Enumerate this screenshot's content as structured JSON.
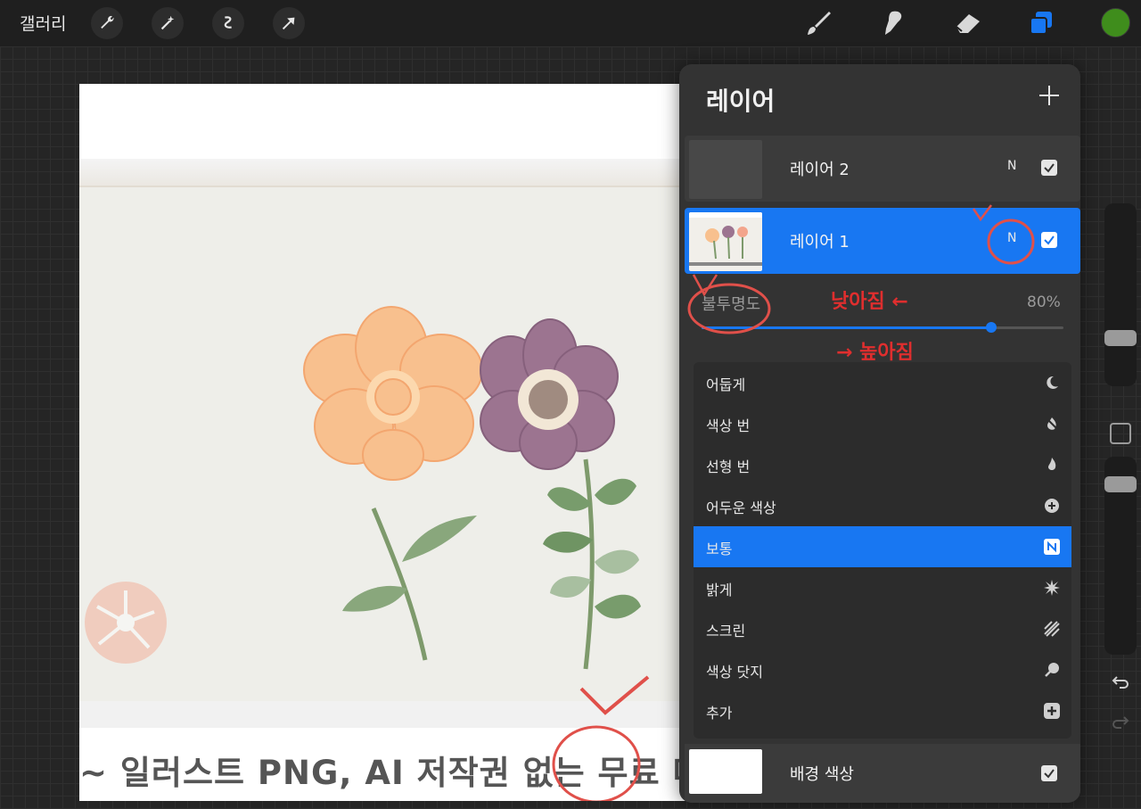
{
  "topbar": {
    "gallery_label": "갤러리",
    "tools_left": [
      {
        "name": "wrench-icon"
      },
      {
        "name": "magic-wand-icon"
      },
      {
        "name": "selection-icon"
      },
      {
        "name": "transform-arrow-icon"
      }
    ],
    "tools_right": [
      {
        "name": "brush-icon"
      },
      {
        "name": "smudge-icon"
      },
      {
        "name": "eraser-icon"
      },
      {
        "name": "layers-icon"
      }
    ],
    "current_color": "#3f8d1c",
    "accent_color": "#1877f2"
  },
  "canvas": {
    "caption": "~ 일러스트 PNG, AI 저작권 없는 무료 다"
  },
  "layers_panel": {
    "title": "레이어",
    "add_icon": "plus-icon",
    "layers": [
      {
        "name": "레이어 2",
        "blend": "N",
        "visible": true,
        "selected": false
      },
      {
        "name": "레이어 1",
        "blend": "N",
        "visible": true,
        "selected": true
      }
    ],
    "opacity": {
      "label": "불투명도",
      "value_text": "80%",
      "value": 0.8
    },
    "blend_modes": [
      {
        "label": "어둡게",
        "icon": "moon-icon",
        "active": false
      },
      {
        "label": "색상 번",
        "icon": "burn-icon",
        "active": false
      },
      {
        "label": "선형 번",
        "icon": "flame-icon",
        "active": false
      },
      {
        "label": "어두운 색상",
        "icon": "plus-circle-icon",
        "active": false
      },
      {
        "label": "보통",
        "icon": "n-badge-icon",
        "active": true,
        "badge": "N"
      },
      {
        "label": "밝게",
        "icon": "sparkle-icon",
        "active": false
      },
      {
        "label": "스크린",
        "icon": "hatch-icon",
        "active": false
      },
      {
        "label": "색상 닷지",
        "icon": "dodge-icon",
        "active": false
      },
      {
        "label": "추가",
        "icon": "plus-square-icon",
        "active": false
      }
    ],
    "background_layer": {
      "name": "배경 색상",
      "visible": true
    }
  },
  "annotations": {
    "lower": "낮아짐 ←",
    "higher": "→ 높아짐"
  },
  "sidebar": {
    "undo_icon": "undo-icon",
    "redo_icon": "redo-icon",
    "modify_icon": "square-icon"
  }
}
